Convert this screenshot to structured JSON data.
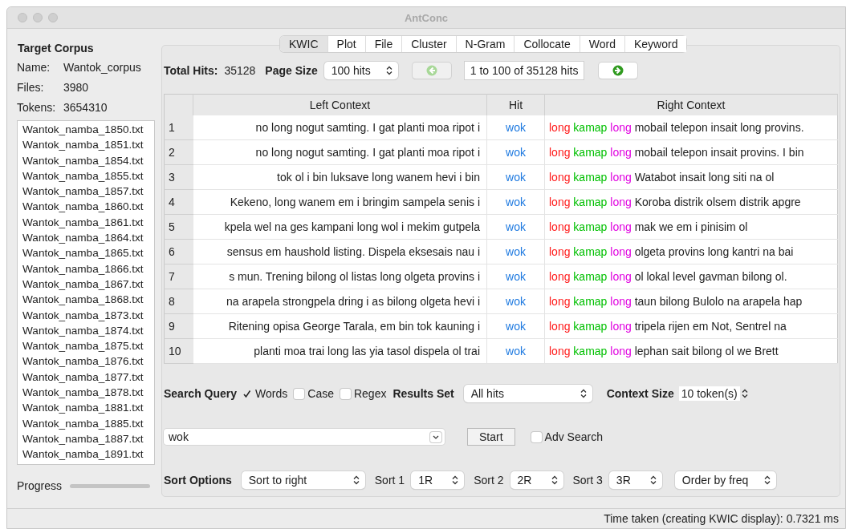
{
  "window": {
    "title": "AntConc"
  },
  "corpus": {
    "heading": "Target Corpus",
    "fields": [
      {
        "label": "Name:",
        "value": "Wantok_corpus"
      },
      {
        "label": "Files:",
        "value": "3980"
      },
      {
        "label": "Tokens:",
        "value": "3654310"
      }
    ],
    "files": [
      "Wantok_namba_1850.txt",
      "Wantok_namba_1851.txt",
      "Wantok_namba_1854.txt",
      "Wantok_namba_1855.txt",
      "Wantok_namba_1857.txt",
      "Wantok_namba_1860.txt",
      "Wantok_namba_1861.txt",
      "Wantok_namba_1864.txt",
      "Wantok_namba_1865.txt",
      "Wantok_namba_1866.txt",
      "Wantok_namba_1867.txt",
      "Wantok_namba_1868.txt",
      "Wantok_namba_1873.txt",
      "Wantok_namba_1874.txt",
      "Wantok_namba_1875.txt",
      "Wantok_namba_1876.txt",
      "Wantok_namba_1877.txt",
      "Wantok_namba_1878.txt",
      "Wantok_namba_1881.txt",
      "Wantok_namba_1885.txt",
      "Wantok_namba_1887.txt",
      "Wantok_namba_1891.txt"
    ],
    "progress_label": "Progress",
    "progress": {
      "level": 0
    }
  },
  "tabs": [
    {
      "label": "KWIC",
      "selected": true
    },
    {
      "label": "Plot",
      "selected": false
    },
    {
      "label": "File",
      "selected": false
    },
    {
      "label": "Cluster",
      "selected": false
    },
    {
      "label": "N-Gram",
      "selected": false
    },
    {
      "label": "Collocate",
      "selected": false
    },
    {
      "label": "Word",
      "selected": false
    },
    {
      "label": "Keyword",
      "selected": false
    }
  ],
  "hits_bar": {
    "total_label": "Total Hits:",
    "total": "35128",
    "page_size_label": "Page Size",
    "page_size": "100 hits",
    "prev_disabled": true,
    "next_disabled": false,
    "range": "1 to 100 of 35128 hits"
  },
  "table": {
    "columns": [
      "Left Context",
      "Hit",
      "Right Context"
    ],
    "rows": [
      {
        "index": "1",
        "left": "no long nogut samting. I gat planti moa ripot i",
        "hit": "wok",
        "right_tokens": [
          {
            "text": "long",
            "color": "#ff1a1a"
          },
          {
            "text": "kamap",
            "color": "#00c000"
          },
          {
            "text": "long",
            "color": "#e000e0"
          }
        ],
        "right": "mobail telepon insait long provins."
      },
      {
        "index": "2",
        "left": "no long nogut samting. I gat planti moa ripot i",
        "hit": "wok",
        "right_tokens": [
          {
            "text": "long",
            "color": "#ff1a1a"
          },
          {
            "text": "kamap",
            "color": "#00c000"
          },
          {
            "text": "long",
            "color": "#e000e0"
          }
        ],
        "right": "mobail telepon insait provins. I bin"
      },
      {
        "index": "3",
        "left": "tok ol i bin luksave long wanem hevi i bin",
        "hit": "wok",
        "right_tokens": [
          {
            "text": "long",
            "color": "#ff1a1a"
          },
          {
            "text": "kamap",
            "color": "#00c000"
          },
          {
            "text": "long",
            "color": "#e000e0"
          }
        ],
        "right": "Watabot insait long siti na ol"
      },
      {
        "index": "4",
        "left": "Kekeno, long wanem em i bringim sampela senis i",
        "hit": "wok",
        "right_tokens": [
          {
            "text": "long",
            "color": "#ff1a1a"
          },
          {
            "text": "kamap",
            "color": "#00c000"
          },
          {
            "text": "long",
            "color": "#e000e0"
          }
        ],
        "right": "Koroba distrik olsem distrik apgre"
      },
      {
        "index": "5",
        "left": "kpela wel na ges kampani long wol i mekim gutpela",
        "hit": "wok",
        "right_tokens": [
          {
            "text": "long",
            "color": "#ff1a1a"
          },
          {
            "text": "kamap",
            "color": "#00c000"
          },
          {
            "text": "long",
            "color": "#e000e0"
          }
        ],
        "right": "mak we em i pinisim ol"
      },
      {
        "index": "6",
        "left": "sensus em haushold listing. Dispela eksesais nau i",
        "hit": "wok",
        "right_tokens": [
          {
            "text": "long",
            "color": "#ff1a1a"
          },
          {
            "text": "kamap",
            "color": "#00c000"
          },
          {
            "text": "long",
            "color": "#e000e0"
          }
        ],
        "right": "olgeta provins long kantri na bai"
      },
      {
        "index": "7",
        "left": "s mun. Trening bilong ol listas long olgeta provins i",
        "hit": "wok",
        "right_tokens": [
          {
            "text": "long",
            "color": "#ff1a1a"
          },
          {
            "text": "kamap",
            "color": "#00c000"
          },
          {
            "text": "long",
            "color": "#e000e0"
          }
        ],
        "right": "ol lokal level gavman bilong ol."
      },
      {
        "index": "8",
        "left": "na arapela strongpela dring i as bilong olgeta hevi i",
        "hit": "wok",
        "right_tokens": [
          {
            "text": "long",
            "color": "#ff1a1a"
          },
          {
            "text": "kamap",
            "color": "#00c000"
          },
          {
            "text": "long",
            "color": "#e000e0"
          }
        ],
        "right": "taun bilong Bulolo na arapela hap"
      },
      {
        "index": "9",
        "left": "Ritening opisa George Tarala, em bin tok kauning i",
        "hit": "wok",
        "right_tokens": [
          {
            "text": "long",
            "color": "#ff1a1a"
          },
          {
            "text": "kamap",
            "color": "#00c000"
          },
          {
            "text": "long",
            "color": "#e000e0"
          }
        ],
        "right": "tripela rijen em Not, Sentrel na"
      },
      {
        "index": "10",
        "left": "planti moa trai long las yia tasol dispela ol trai",
        "hit": "wok",
        "right_tokens": [
          {
            "text": "long",
            "color": "#ff1a1a"
          },
          {
            "text": "kamap",
            "color": "#00c000"
          },
          {
            "text": "long",
            "color": "#e000e0"
          }
        ],
        "right": "lephan sait bilong ol we Brett"
      }
    ]
  },
  "search": {
    "label": "Search Query",
    "options": [
      {
        "label": "Words",
        "checked": true
      },
      {
        "label": "Case",
        "checked": false
      },
      {
        "label": "Regex",
        "checked": false
      }
    ],
    "results_set_label": "Results Set",
    "results_set": "All hits",
    "context_size_label": "Context Size",
    "context_size": "10 token(s)",
    "query": "wok",
    "start": "Start",
    "adv_search": {
      "label": "Adv Search",
      "checked": false
    }
  },
  "sort": {
    "label": "Sort Options",
    "mode": "Sort to right",
    "levels": [
      {
        "label": "Sort 1",
        "value": "1R"
      },
      {
        "label": "Sort 2",
        "value": "2R"
      },
      {
        "label": "Sort 3",
        "value": "3R"
      }
    ],
    "order": "Order by freq"
  },
  "status_bar": "Time taken (creating KWIC display): 0.7321 ms"
}
